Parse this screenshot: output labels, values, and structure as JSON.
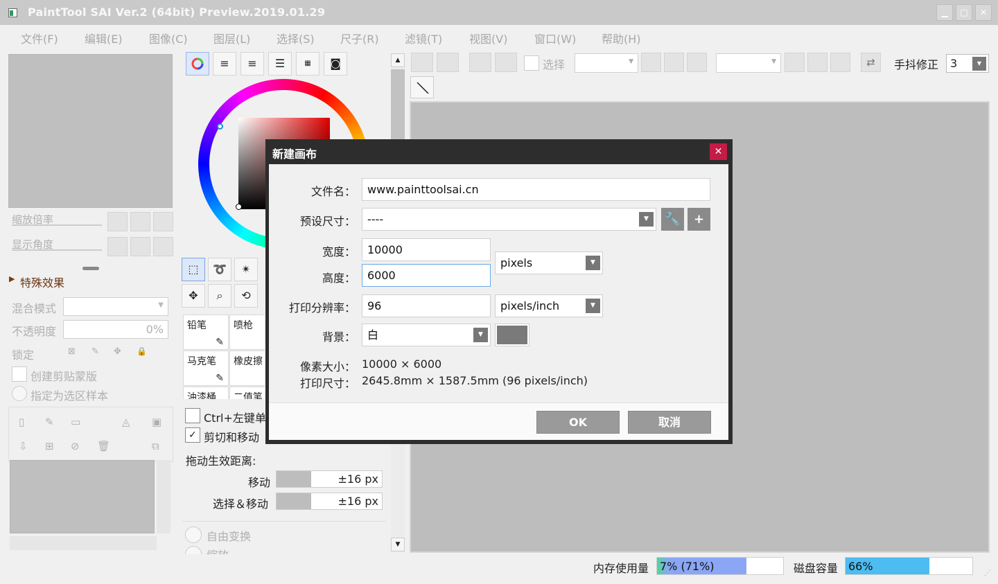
{
  "window": {
    "title": "PaintTool SAI Ver.2 (64bit) Preview.2019.01.29",
    "controls": {
      "minimize": "▁",
      "maximize": "□",
      "close": "✕"
    }
  },
  "menu": [
    "文件(F)",
    "编辑(E)",
    "图像(C)",
    "图层(L)",
    "选择(S)",
    "尺子(R)",
    "滤镜(T)",
    "视图(V)",
    "窗口(W)",
    "帮助(H)"
  ],
  "left_panel": {
    "zoom_label": "缩放倍率",
    "angle_label": "显示角度",
    "effects_label": "特殊效果",
    "blend_label": "混合模式",
    "opacity_label": "不透明度",
    "opacity_value": "0%",
    "lock_label": "锁定",
    "clip_label": "创建剪贴蒙版",
    "sample_label": "指定为选区样本"
  },
  "mid_panel": {
    "brushes": [
      "铅笔",
      "喷枪",
      "马克笔",
      "橡皮擦",
      "油漆桶",
      "二值笔"
    ],
    "ctrl_click_label": "Ctrl+左键单",
    "cut_move_label": "剪切和移动",
    "drag_dist_label": "拖动生效距离:",
    "move_label": "移动",
    "move_value": "±16 px",
    "select_move_label": "选择＆移动",
    "select_move_value": "±16 px",
    "free_transform_label": "自由变换",
    "scale_label": "缩放"
  },
  "toolbar": {
    "select_label": "选择",
    "stabilizer_label": "手抖修正",
    "stabilizer_value": "3"
  },
  "dialog": {
    "title": "新建画布",
    "filename_label": "文件名：",
    "filename_value": "www.painttoolsai.cn",
    "preset_label": "预设尺寸：",
    "preset_value": "----",
    "width_label": "宽度：",
    "width_value": "10000",
    "height_label": "高度：",
    "height_value": "6000",
    "unit_value": "pixels",
    "dpi_label": "打印分辨率：",
    "dpi_value": "96",
    "dpi_unit": "pixels/inch",
    "bg_label": "背景：",
    "bg_value": "白",
    "pixel_size_label": "像素大小：",
    "pixel_size_value": "10000 × 6000",
    "print_size_label": "打印尺寸：",
    "print_size_value": "2645.8mm × 1587.5mm (96 pixels/inch)",
    "ok_label": "OK",
    "cancel_label": "取消"
  },
  "status": {
    "memory_label": "内存使用量",
    "memory_value": "7% (71%)",
    "memory_fraction": 0.71,
    "disk_label": "磁盘容量",
    "disk_value": "66%",
    "disk_fraction": 0.66
  },
  "colors": {
    "dialog_close": "#c51b46",
    "memory_fill": "#8aa6f4",
    "disk_fill": "#4dbcf0"
  }
}
